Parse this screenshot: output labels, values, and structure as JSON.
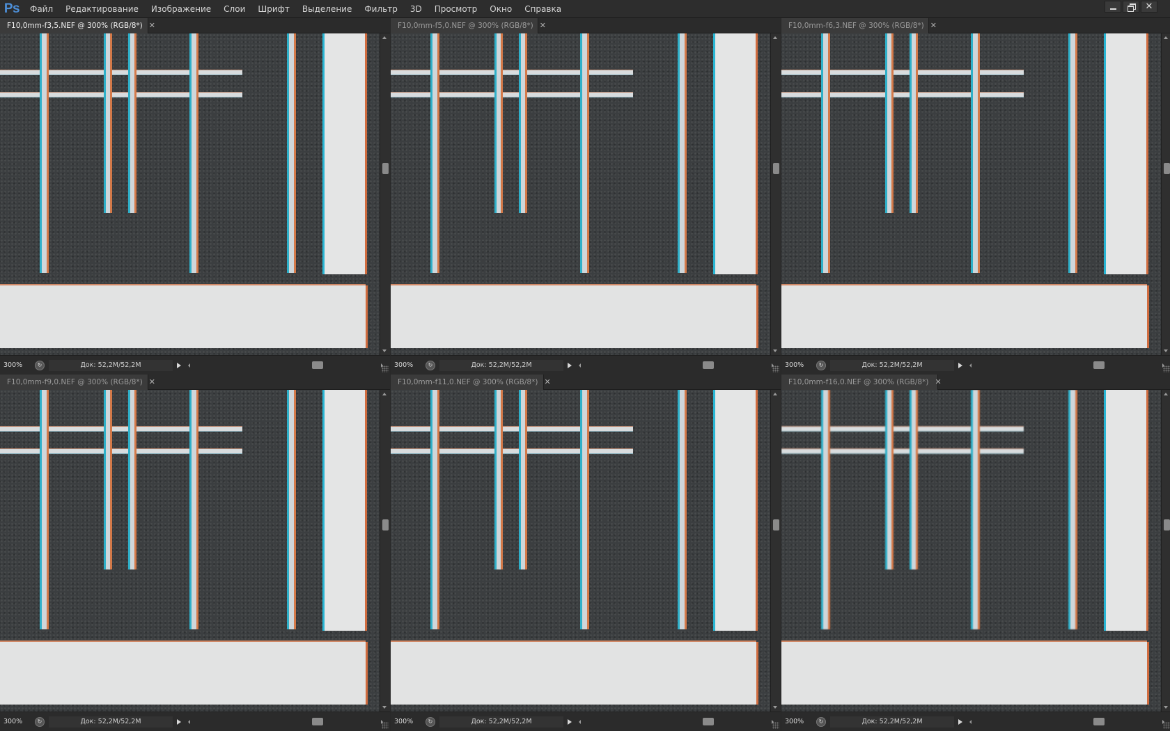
{
  "app": {
    "logo": "Ps",
    "menu": [
      "Файл",
      "Редактирование",
      "Изображение",
      "Слои",
      "Шрифт",
      "Выделение",
      "Фильтр",
      "3D",
      "Просмотр",
      "Окно",
      "Справка"
    ],
    "window_controls": [
      "minimize-icon",
      "restore-icon",
      "close-icon"
    ]
  },
  "documents": [
    {
      "title": "F10,0mm-f3,5.NEF @ 300% (RGB/8*)",
      "zoom": "300%",
      "doc_size": "Док: 52,2M/52,2M",
      "active": true
    },
    {
      "title": "F10,0mm-f5,0.NEF @ 300% (RGB/8*)",
      "zoom": "300%",
      "doc_size": "Док: 52,2M/52,2M",
      "active": false
    },
    {
      "title": "F10,0mm-f6,3.NEF @ 300% (RGB/8*)",
      "zoom": "300%",
      "doc_size": "Док: 52,2M/52,2M",
      "active": false
    },
    {
      "title": "F10,0mm-f9,0.NEF @ 300% (RGB/8*)",
      "zoom": "300%",
      "doc_size": "Док: 52,2M/52,2M",
      "active": false
    },
    {
      "title": "F10,0mm-f11,0.NEF @ 300% (RGB/8*)",
      "zoom": "300%",
      "doc_size": "Док: 52,2M/52,2M",
      "active": false
    },
    {
      "title": "F10,0mm-f16,0.NEF @ 300% (RGB/8*)",
      "zoom": "300%",
      "doc_size": "Док: 52,2M/52,2M",
      "active": false
    }
  ],
  "colors": {
    "ui_background": "#2b2b2b",
    "canvas_background": "#3b3e40",
    "chart_white": "#e4e5e5",
    "cyan_fringe": "#2fb0c9",
    "orange_fringe": "#d47a4a"
  }
}
